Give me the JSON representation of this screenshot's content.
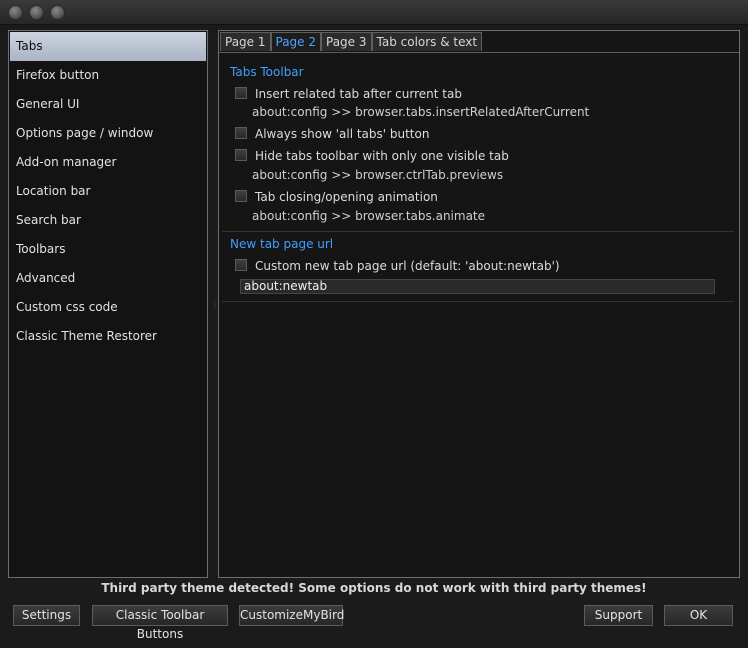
{
  "sidebar": {
    "items": [
      {
        "label": "Tabs",
        "selected": true
      },
      {
        "label": "Firefox button"
      },
      {
        "label": "General UI"
      },
      {
        "label": "Options page / window"
      },
      {
        "label": "Add-on manager"
      },
      {
        "label": "Location bar"
      },
      {
        "label": "Search bar"
      },
      {
        "label": "Toolbars"
      },
      {
        "label": "Advanced"
      },
      {
        "label": "Custom css code"
      },
      {
        "label": "Classic Theme Restorer"
      }
    ]
  },
  "tabs": [
    {
      "label": "Page 1"
    },
    {
      "label": "Page 2",
      "active": true
    },
    {
      "label": "Page 3"
    },
    {
      "label": "Tab colors & text"
    }
  ],
  "tabs_toolbar": {
    "title": "Tabs Toolbar",
    "options": [
      {
        "label": "Insert related tab after current tab",
        "checked": false,
        "config": "about:config >> browser.tabs.insertRelatedAfterCurrent"
      },
      {
        "label": "Always show 'all tabs' button",
        "checked": false
      },
      {
        "label": "Hide tabs toolbar with only one visible tab",
        "checked": false,
        "config": "about:config >> browser.ctrlTab.previews"
      },
      {
        "label": "Tab closing/opening animation",
        "checked": false,
        "config": "about:config >> browser.tabs.animate"
      }
    ]
  },
  "new_tab": {
    "title": "New tab page url",
    "option": {
      "label": "Custom new tab page url (default: 'about:newtab')",
      "checked": false
    },
    "url_value": "about:newtab"
  },
  "footer": {
    "warning": "Third party theme detected! Some options do not work with third party themes!",
    "buttons": {
      "settings": "Settings",
      "classic_toolbar": "Classic Toolbar Buttons",
      "customize": "CustomizeMyBird",
      "support": "Support",
      "ok": "OK"
    }
  },
  "colors": {
    "accent": "#3fa0ff",
    "background": "#1b1b1b",
    "selected_item": "#b7c0cf"
  }
}
